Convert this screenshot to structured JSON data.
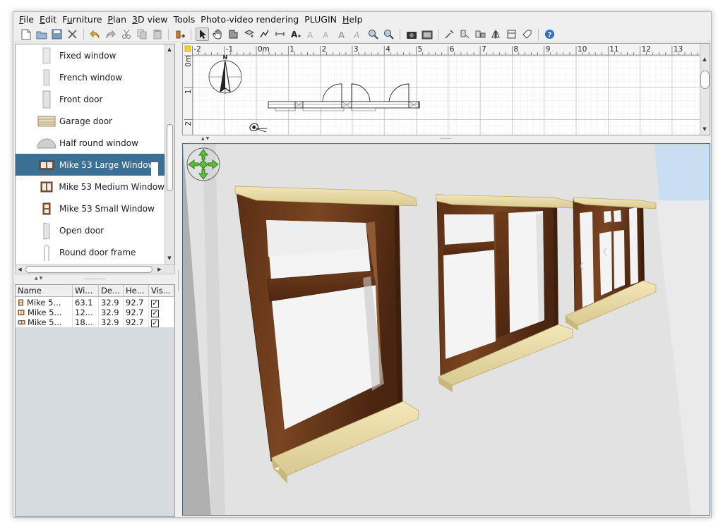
{
  "menu": [
    "File",
    "Edit",
    "Furniture",
    "Plan",
    "3D view",
    "Tools",
    "Photo-video rendering",
    "PLUGIN",
    "Help"
  ],
  "menu_underline": [
    0,
    0,
    1,
    0,
    0,
    null,
    null,
    null,
    0
  ],
  "toolbar_icons": [
    "new-icon",
    "open-icon",
    "save-icon",
    "cut-prefs-icon",
    "undo-icon",
    "redo-icon",
    "cut-icon",
    "copy-icon",
    "paste-icon",
    "add-furniture-icon",
    "select-icon",
    "pan-icon",
    "create-walls-icon",
    "create-rooms-icon",
    "create-polylines-icon",
    "create-dimensions-icon",
    "add-text-icon",
    "text-style-icon",
    "bold-icon",
    "italic-icon",
    "text-size-icon",
    "zoom-in-icon",
    "zoom-out-icon",
    "photo-icon",
    "video-icon",
    "import-furniture-icon",
    "modify-furniture-icon",
    "flip-icon",
    "mirror-icon",
    "preferences-icon",
    "help-icon"
  ],
  "catalog": {
    "items": [
      {
        "label": "Fixed window",
        "thumb": "fixed-window-icon"
      },
      {
        "label": "French window",
        "thumb": "french-window-icon"
      },
      {
        "label": "Front door",
        "thumb": "front-door-icon"
      },
      {
        "label": "Garage door",
        "thumb": "garage-door-icon"
      },
      {
        "label": "Half round window",
        "thumb": "half-round-window-icon"
      },
      {
        "label": "Mike 53 Large Window",
        "thumb": "large-window-icon",
        "selected": true
      },
      {
        "label": "Mike 53 Medium Window",
        "thumb": "medium-window-icon"
      },
      {
        "label": "Mike 53 Small Window",
        "thumb": "small-window-icon"
      },
      {
        "label": "Open door",
        "thumb": "open-door-icon"
      },
      {
        "label": "Round door frame",
        "thumb": "round-door-frame-icon"
      }
    ]
  },
  "furniture_table": {
    "headers": [
      "Name",
      "Wi...",
      "De...",
      "He...",
      "Vis..."
    ],
    "rows": [
      {
        "name": "Mike 5...",
        "width": "63.1",
        "depth": "32.9",
        "height": "92.7",
        "visible": "✓"
      },
      {
        "name": "Mike 5...",
        "width": "12...",
        "depth": "32.9",
        "height": "92.7",
        "visible": "✓"
      },
      {
        "name": "Mike 5...",
        "width": "18...",
        "depth": "32.9",
        "height": "92.7",
        "visible": "✓"
      }
    ]
  },
  "plan": {
    "ruler_x": [
      "-2",
      "-1",
      "0m",
      "1",
      "2",
      "3",
      "4",
      "5",
      "6",
      "7",
      "8",
      "9",
      "10",
      "11",
      "12",
      "13"
    ],
    "ruler_y": [
      "0m",
      "1",
      "2"
    ],
    "compass_label": "N"
  },
  "colors": {
    "selection": "#3c6f94",
    "wood": "#6b3a1c",
    "sill": "#efe2ad"
  }
}
